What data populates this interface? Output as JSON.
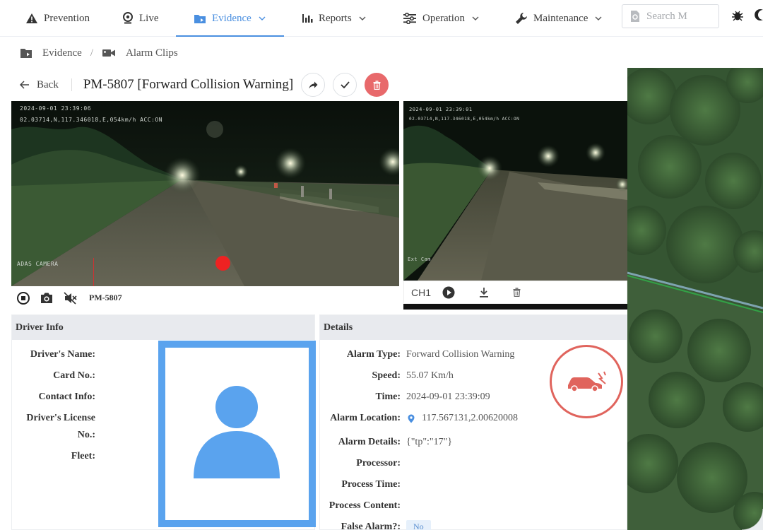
{
  "nav": {
    "items": [
      {
        "label": "Prevention",
        "icon": "warning-icon"
      },
      {
        "label": "Live",
        "icon": "webcam-icon"
      },
      {
        "label": "Evidence",
        "icon": "folder-video-icon",
        "active": true
      },
      {
        "label": "Reports",
        "icon": "bar-chart-icon"
      },
      {
        "label": "Operation",
        "icon": "sliders-icon"
      },
      {
        "label": "Maintenance",
        "icon": "wrench-icon"
      }
    ],
    "search_placeholder": "Search M"
  },
  "breadcrumb": {
    "root": "Evidence",
    "separator": "/",
    "current": "Alarm Clips"
  },
  "header": {
    "back_label": "Back",
    "title": "PM-5807 [Forward Collision Warning]"
  },
  "video": {
    "main_osd_time": "2024-09-01 23:39:06",
    "main_osd_gps": "02.03714,N,117.346018,E,054km/h ACC:ON",
    "main_osd_cam": "ADAS CAMERA",
    "side_osd_time": "2024-09-01 23:39:01",
    "side_osd_gps": "02.03714,N,117.346018,E,054km/h ACC:ON",
    "side_osd_cam": "Ext Cam",
    "plate": "PM-5807",
    "channel": "CH1"
  },
  "driver": {
    "section_title": "Driver Info",
    "labels": {
      "name": "Driver's Name:",
      "card": "Card No.:",
      "contact": "Contact Info:",
      "license_1": "Driver's License",
      "license_2": "No.:",
      "fleet": "Fleet:"
    }
  },
  "details": {
    "section_title": "Details",
    "alarm_type_label": "Alarm Type:",
    "alarm_type": "Forward Collision Warning",
    "speed_label": "Speed:",
    "speed": "55.07 Km/h",
    "time_label": "Time:",
    "time": "2024-09-01 23:39:09",
    "location_label": "Alarm Location:",
    "location": "117.567131,2.00620008",
    "alarm_details_label": "Alarm Details:",
    "alarm_details": "{\"tp\":\"17\"}",
    "processor_label": "Processor:",
    "process_time_label": "Process Time:",
    "process_content_label": "Process Content:",
    "false_alarm_label": "False Alarm?:",
    "false_alarm": "No"
  },
  "colors": {
    "accent": "#4a8fe0",
    "danger": "#e8696b",
    "avatar": "#5aa3ee"
  }
}
